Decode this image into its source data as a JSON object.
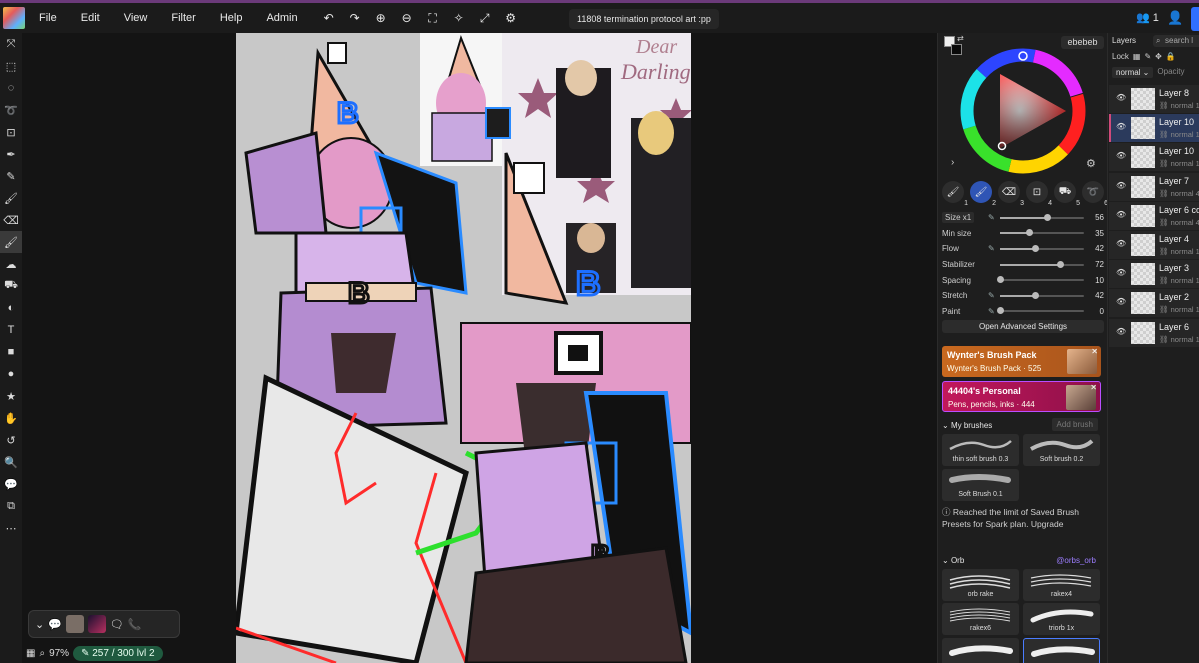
{
  "menu": {
    "items": [
      "File",
      "Edit",
      "View",
      "Filter",
      "Help",
      "Admin"
    ]
  },
  "document": {
    "title": "11808 termination protocol art :pp"
  },
  "header": {
    "user_count": "1"
  },
  "icons": {
    "undo": "undo-icon",
    "redo": "redo-icon",
    "zoom_in": "zoom-in-icon",
    "zoom_out": "zoom-out-icon",
    "fit": "fit-icon",
    "sparkle": "sparkle-icon",
    "fullscreen": "fullscreen-icon",
    "settings": "settings-icon"
  },
  "status": {
    "zoom": "97%",
    "brush_limit": "257 / 300",
    "level": "lvl 2"
  },
  "color": {
    "hex": "ebebeb",
    "accent": "#2f55b5"
  },
  "brush_tabs": [
    "1",
    "2",
    "3",
    "4",
    "5",
    "6"
  ],
  "settings": {
    "size_label": "Size x1",
    "rows": [
      {
        "label": "",
        "value": "56",
        "fraction": 0.56
      },
      {
        "label": "Min size",
        "value": "35",
        "fraction": 0.35
      },
      {
        "label": "Flow",
        "value": "42",
        "fraction": 0.42
      },
      {
        "label": "Stabilizer",
        "value": "72",
        "fraction": 0.72
      },
      {
        "label": "Spacing",
        "value": "10",
        "fraction": 0.0
      },
      {
        "label": "Stretch",
        "value": "42",
        "fraction": 0.42
      },
      {
        "label": "Paint",
        "value": "0",
        "fraction": 0.0
      }
    ],
    "advanced_label": "Open Advanced Settings"
  },
  "packs": [
    {
      "title": "Wynter's Brush Pack",
      "subtitle": "Wynter's Brush Pack · 525"
    },
    {
      "title": "44404's Personal",
      "subtitle": "Pens, pencils, inks · 444"
    }
  ],
  "my_brushes": {
    "header": "My brushes",
    "add_label": "Add brush",
    "items": [
      "thin soft brush 0.3",
      "Soft brush 0.2",
      "Soft Brush 0.1"
    ]
  },
  "limit_note": "Reached the limit of Saved Brush Presets for Spark plan. Upgrade",
  "orb": {
    "header": "Orb",
    "link": "@orbs_orb",
    "items": [
      "orb rake",
      "rakex4",
      "rakex6",
      "triorb 1x",
      "",
      ""
    ]
  },
  "layers": {
    "header": "Layers",
    "search_placeholder": "search l",
    "lock_label": "Lock",
    "blend_mode": "normal",
    "opacity_label": "Opacity",
    "items": [
      {
        "name": "Layer 8",
        "mode": "normal 1",
        "selected": false
      },
      {
        "name": "Layer 10",
        "mode": "normal 1",
        "selected": true
      },
      {
        "name": "Layer 10",
        "mode": "normal 1",
        "selected": false
      },
      {
        "name": "Layer 7",
        "mode": "normal 4",
        "selected": false
      },
      {
        "name": "Layer 6 co",
        "mode": "normal 4",
        "selected": false
      },
      {
        "name": "Layer 4",
        "mode": "normal 1",
        "selected": false
      },
      {
        "name": "Layer 3",
        "mode": "normal 1",
        "selected": false
      },
      {
        "name": "Layer 2",
        "mode": "normal 1",
        "selected": false
      },
      {
        "name": "Layer 6",
        "mode": "normal 1",
        "selected": false
      }
    ]
  }
}
